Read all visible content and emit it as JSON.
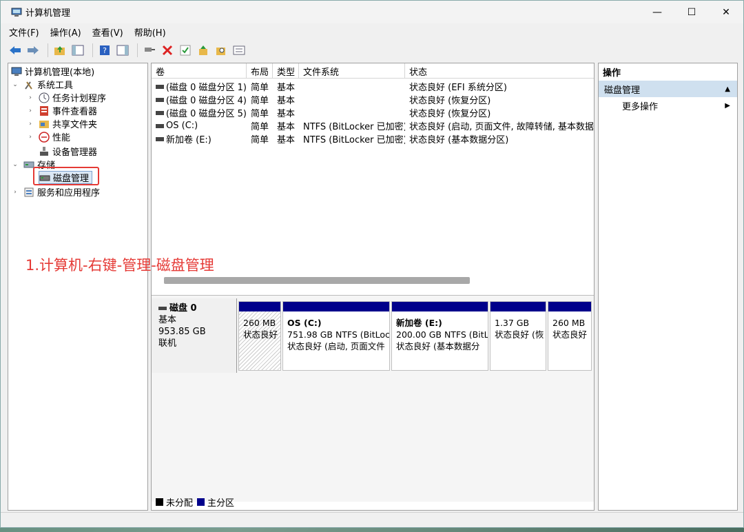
{
  "window": {
    "title": "计算机管理",
    "min": "—",
    "max": "☐",
    "close": "✕"
  },
  "menu": [
    "文件(F)",
    "操作(A)",
    "查看(V)",
    "帮助(H)"
  ],
  "tree": {
    "root": "计算机管理(本地)",
    "system_tools": "系统工具",
    "task_scheduler": "任务计划程序",
    "event_viewer": "事件查看器",
    "shared_folders": "共享文件夹",
    "performance": "性能",
    "device_manager": "设备管理器",
    "storage": "存储",
    "disk_management": "磁盘管理",
    "services_apps": "服务和应用程序"
  },
  "annotation": "1.计算机-右键-管理-磁盘管理",
  "volume_list": {
    "headers": [
      "卷",
      "布局",
      "类型",
      "文件系统",
      "状态"
    ],
    "rows": [
      [
        "(磁盘 0 磁盘分区 1)",
        "简单",
        "基本",
        "",
        "状态良好 (EFI 系统分区)"
      ],
      [
        "(磁盘 0 磁盘分区 4)",
        "简单",
        "基本",
        "",
        "状态良好 (恢复分区)"
      ],
      [
        "(磁盘 0 磁盘分区 5)",
        "简单",
        "基本",
        "",
        "状态良好 (恢复分区)"
      ],
      [
        "OS (C:)",
        "简单",
        "基本",
        "NTFS (BitLocker 已加密)",
        "状态良好 (启动, 页面文件, 故障转储, 基本数据分"
      ],
      [
        "新加卷 (E:)",
        "简单",
        "基本",
        "NTFS (BitLocker 已加密)",
        "状态良好 (基本数据分区)"
      ]
    ]
  },
  "disk": {
    "name": "磁盘 0",
    "type": "基本",
    "size": "953.85 GB",
    "state": "联机",
    "partitions": [
      {
        "title": "",
        "line1": "260 MB",
        "line2": "状态良好"
      },
      {
        "title": "OS  (C:)",
        "line1": "751.98 GB NTFS (BitLoc",
        "line2": "状态良好 (启动, 页面文件"
      },
      {
        "title": "新加卷  (E:)",
        "line1": "200.00 GB NTFS (BitL",
        "line2": "状态良好 (基本数据分"
      },
      {
        "title": "",
        "line1": "1.37 GB",
        "line2": "状态良好 (恢"
      },
      {
        "title": "",
        "line1": "260 MB",
        "line2": "状态良好"
      }
    ]
  },
  "legend": {
    "unallocated": "未分配",
    "primary": "主分区"
  },
  "actions": {
    "header": "操作",
    "section": "磁盘管理",
    "more": "更多操作"
  },
  "colors": {
    "primary_partition": "#00008b",
    "annotation": "#e53935",
    "selection": "#cfe0ef"
  }
}
